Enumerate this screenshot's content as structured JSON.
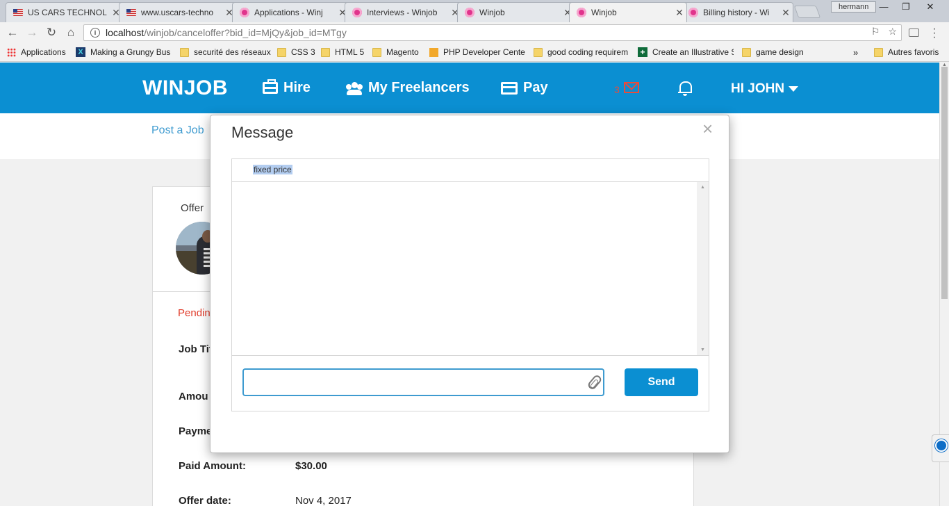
{
  "browser": {
    "tabs": [
      {
        "title": "US CARS TECHNOL",
        "icon": "us-flag-icon"
      },
      {
        "title": "www.uscars-techno",
        "icon": "us-flag-icon"
      },
      {
        "title": "Applications - Winj",
        "icon": "winjob-icon"
      },
      {
        "title": "Interviews - Winjob",
        "icon": "winjob-icon"
      },
      {
        "title": "Winjob",
        "icon": "winjob-icon"
      },
      {
        "title": "Winjob",
        "icon": "winjob-icon",
        "active": true
      },
      {
        "title": "Billing history - Wi",
        "icon": "winjob-icon"
      }
    ],
    "profile_name": "hermann",
    "url_host": "localhost",
    "url_path": "/winjob/canceloffer?bid_id=MjQy&job_id=MTgy",
    "bookmarks": [
      {
        "label": "Applications",
        "icon": "apps-grid-icon"
      },
      {
        "label": "Making a Grungy Bus",
        "icon": "x-icon"
      },
      {
        "label": "securité des réseaux",
        "icon": "folder-icon"
      },
      {
        "label": "CSS 3",
        "icon": "folder-icon"
      },
      {
        "label": "HTML 5",
        "icon": "folder-icon"
      },
      {
        "label": "Magento",
        "icon": "folder-icon"
      },
      {
        "label": "PHP Developer Cente",
        "icon": "box-icon"
      },
      {
        "label": "good coding requirem",
        "icon": "folder-icon"
      },
      {
        "label": "Create an Illustrative S",
        "icon": "plus-icon"
      },
      {
        "label": "game design",
        "icon": "folder-icon"
      },
      {
        "label": "Autres favoris",
        "icon": "folder-icon"
      }
    ],
    "bookmarks_overflow": "»"
  },
  "nav": {
    "brand": "WINJOB",
    "hire": "Hire",
    "freelancers": "My Freelancers",
    "pay": "Pay",
    "mail_count": "3",
    "user": "HI JOHN"
  },
  "subnav": {
    "post_job": "Post a Job"
  },
  "offer": {
    "title": "Offer",
    "status": "Pendin",
    "rows": [
      {
        "label": "Job Tit",
        "value": ""
      },
      {
        "label": "Amou",
        "value": ""
      },
      {
        "label": "Payme",
        "value": ""
      },
      {
        "label": "Paid Amount:",
        "value": "$30.00"
      },
      {
        "label": "Offer date:",
        "value": "Nov 4, 2017"
      }
    ]
  },
  "modal": {
    "title": "Message",
    "close": "×",
    "subject": "fixed price",
    "composer_value": "",
    "send": "Send"
  },
  "colors": {
    "brand_blue": "#0b8fd2",
    "link_blue": "#3e9bd0",
    "pending_red": "#e03b2a",
    "mail_red": "#e74c3c"
  }
}
